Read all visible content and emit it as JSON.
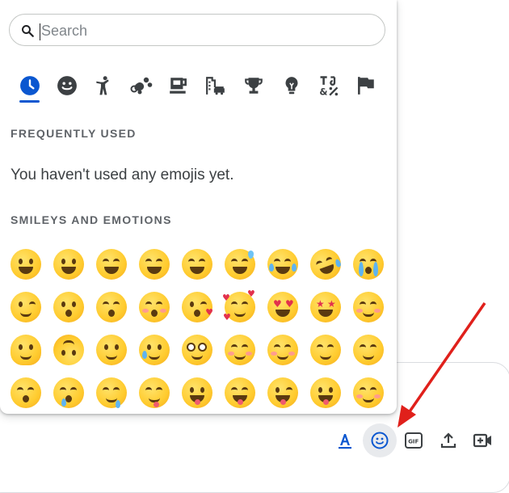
{
  "search": {
    "placeholder": "Search",
    "value": ""
  },
  "categories": [
    {
      "name": "recent",
      "icon": "clock-icon",
      "active": true
    },
    {
      "name": "smileys",
      "icon": "smiley-icon"
    },
    {
      "name": "people",
      "icon": "person-icon"
    },
    {
      "name": "animals",
      "icon": "paw-icon"
    },
    {
      "name": "food",
      "icon": "coffee-icon"
    },
    {
      "name": "travel",
      "icon": "buildings-icon"
    },
    {
      "name": "activities",
      "icon": "trophy-icon"
    },
    {
      "name": "objects",
      "icon": "lightbulb-icon"
    },
    {
      "name": "symbols",
      "icon": "symbols-icon"
    },
    {
      "name": "flags",
      "icon": "flag-icon"
    }
  ],
  "sections": {
    "frequent_title": "FREQUENTLY USED",
    "frequent_empty": "You haven't used any emojis yet.",
    "smileys_title": "SMILEYS AND EMOTIONS"
  },
  "emojis": [
    [
      "grinning-face",
      "grinning-face-big-eyes",
      "grinning-face-smiling-eyes",
      "beaming-face",
      "grinning-squinting-face",
      "grinning-face-sweat",
      "face-tears-of-joy",
      "rolling-on-floor-laughing",
      "loudly-crying-face"
    ],
    [
      "winking-face",
      "kissing-face",
      "kissing-face-smiling-eyes",
      "kissing-face-closed-eyes",
      "face-blowing-kiss",
      "smiling-face-hearts",
      "heart-eyes",
      "star-struck",
      "partying-face"
    ],
    [
      "melting-face",
      "upside-down-face",
      "slightly-smiling-face",
      "smiling-face-tear",
      "face-holding-back-tears",
      "smiling-face-smiling-eyes",
      "smiling-face",
      "relieved-face",
      "smirking-face"
    ],
    [
      "sleeping-face",
      "sleepy-face",
      "drooling-face",
      "face-savoring-food",
      "face-with-tongue",
      "squinting-face-tongue",
      "winking-face-tongue",
      "zany-face",
      "woozy-face"
    ]
  ],
  "toolbar": [
    {
      "name": "format-text-button",
      "icon": "text-format-icon"
    },
    {
      "name": "emoji-button",
      "icon": "emoji-icon",
      "active": true
    },
    {
      "name": "gif-button",
      "icon": "gif-icon"
    },
    {
      "name": "upload-button",
      "icon": "upload-icon"
    },
    {
      "name": "video-meeting-button",
      "icon": "video-add-icon"
    }
  ],
  "colors": {
    "accent": "#0b57d0",
    "icon": "#3c4043",
    "arrow": "#e0201b",
    "text_muted": "#5f6368"
  }
}
